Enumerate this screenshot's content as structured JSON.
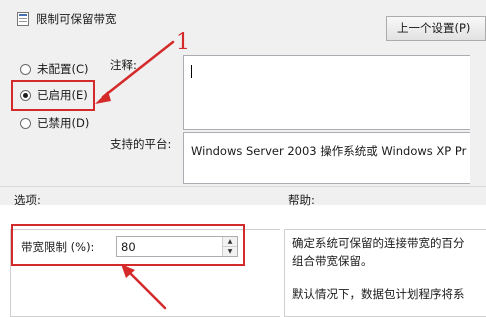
{
  "window": {
    "title": "限制可保留带宽"
  },
  "toolbar": {
    "prev_setting_button": "上一个设置(P)"
  },
  "options": [
    {
      "label": "未配置(C)",
      "checked": false
    },
    {
      "label": "已启用(E)",
      "checked": true
    },
    {
      "label": "已禁用(D)",
      "checked": false
    }
  ],
  "comment": {
    "label": "注释:",
    "value": ""
  },
  "platform": {
    "label": "支持的平台:",
    "value": "Windows Server 2003 操作系统或 Windows XP Pr"
  },
  "sections": {
    "options_label": "选项:",
    "help_label": "帮助:"
  },
  "bandwidth": {
    "label": "带宽限制 (%):",
    "value": "80"
  },
  "help": {
    "line1": "确定系统可保留的连接带宽的百分",
    "line2": "组合带宽保留。",
    "line3": "默认情况下，数据包计划程序将系"
  },
  "annotations": {
    "step_number": "1",
    "color": "#d42a2a"
  }
}
